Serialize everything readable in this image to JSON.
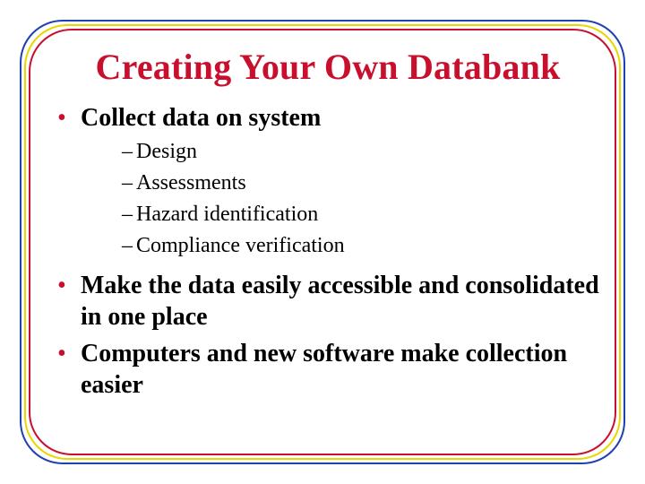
{
  "colors": {
    "border_outer": "#1f3fb5",
    "border_mid": "#e6d700",
    "border_inner": "#c8102e",
    "title": "#c8102e",
    "bullet": "#c8102e",
    "text": "#000000"
  },
  "slide": {
    "title": "Creating Your Own Databank",
    "bullets": [
      {
        "text": "Collect data on system",
        "sub": [
          "Design",
          "Assessments",
          "Hazard identification",
          "Compliance verification"
        ]
      },
      {
        "text": "Make the data easily accessible and consolidated in one place",
        "sub": []
      },
      {
        "text": "Computers and new software make collection easier",
        "sub": []
      }
    ]
  }
}
